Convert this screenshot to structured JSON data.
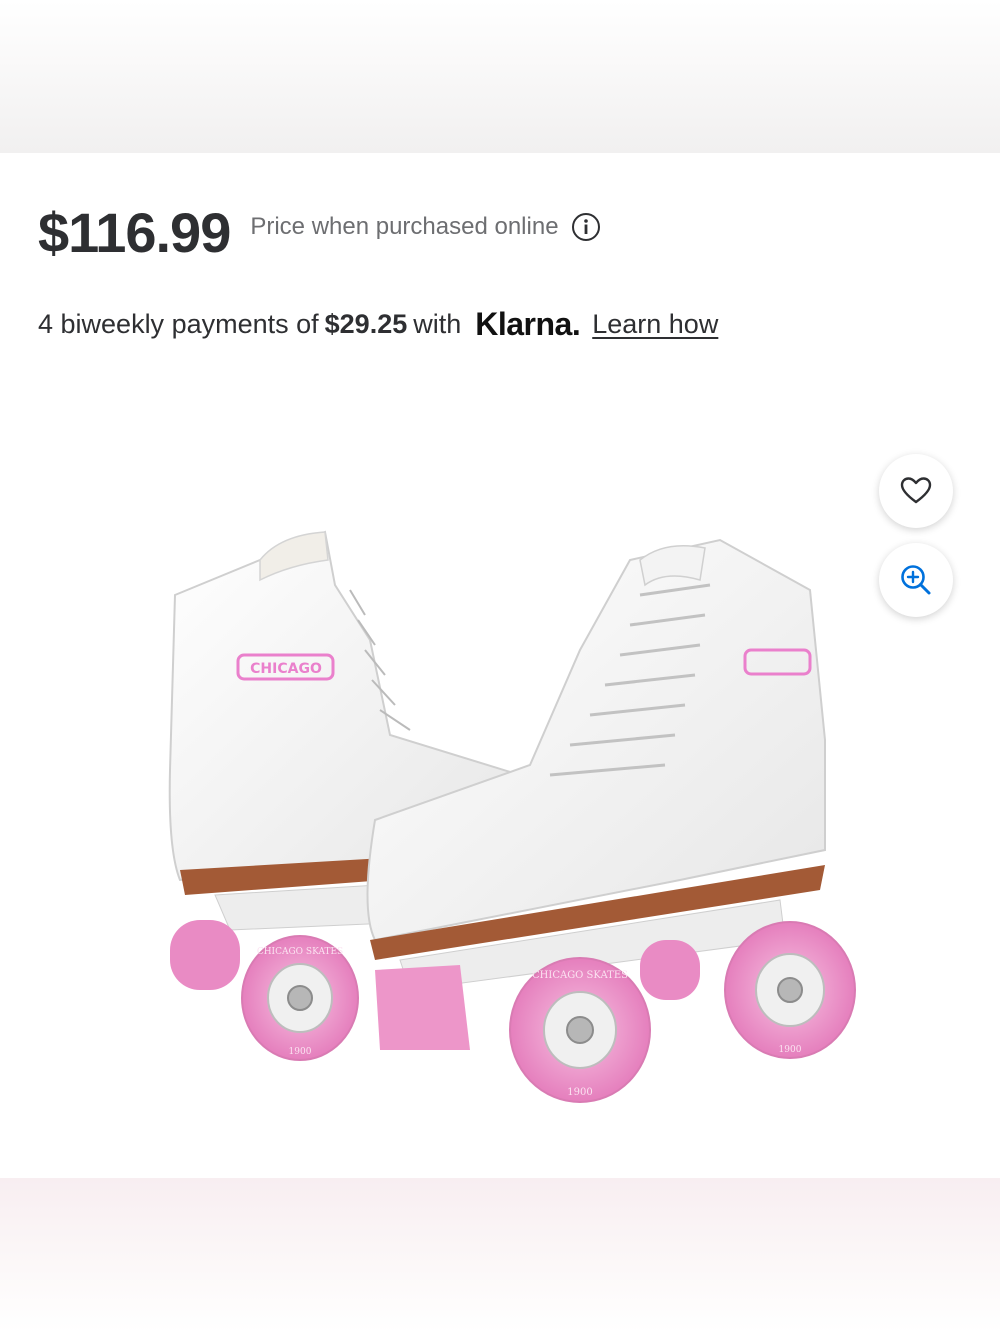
{
  "product": {
    "price": "$116.99",
    "price_note": "Price when purchased online",
    "payments_prefix": "4 biweekly payments of",
    "payment_amount": "$29.25",
    "payments_with": "with",
    "provider": "Klarna.",
    "learn_link": "Learn how",
    "image_alt": "White quad roller skates with pink wheels"
  },
  "image_text": {
    "brand": "CHICAGO",
    "wheel_text": "CHICAGO SKATES",
    "wheel_year": "1900"
  },
  "actions": {
    "favorite_icon": "heart-icon",
    "zoom_icon": "zoom-in-icon",
    "info_icon": "info-icon"
  },
  "colors": {
    "text": "#2e2f32",
    "muted": "#6d6e71",
    "zoom_blue": "#0071dc",
    "wheel_pink": "#e98bc4"
  }
}
